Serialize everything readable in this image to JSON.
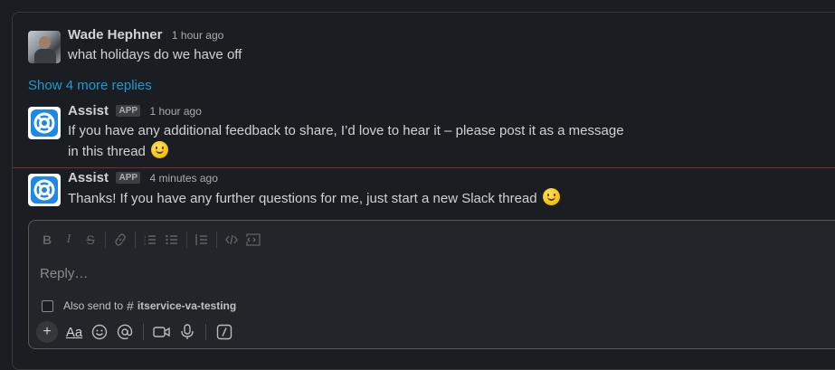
{
  "thread": {
    "messages": [
      {
        "sender": "Wade Hephner",
        "time": "1 hour ago",
        "text": "what holidays do we have off",
        "avatar": "user-photo"
      },
      {
        "sender": "Assist",
        "badge": "APP",
        "time": "1 hour ago",
        "text_line1": "If you have any additional feedback to share, I’d love to hear it – please post it as a message",
        "text_line2": "in this thread",
        "emoji": "slightly-smiling-face",
        "avatar": "assist-logo-icon"
      },
      {
        "sender": "Assist",
        "badge": "APP",
        "time": "4 minutes ago",
        "text": "Thanks! If you have any further questions for me, just start a new Slack thread",
        "emoji": "slightly-smiling-face",
        "avatar": "assist-logo-icon"
      }
    ],
    "more_replies_label": "Show 4 more replies"
  },
  "composer": {
    "placeholder": "Reply…",
    "also_send_label": "Also send to",
    "channel_hash": "#",
    "channel_name": "itservice-va-testing",
    "format_icons": [
      "bold",
      "italic",
      "strikethrough",
      "link",
      "ordered-list",
      "bulleted-list",
      "blockquote",
      "code",
      "code-block"
    ],
    "bottom_icons": [
      "plus",
      "text-formatting",
      "emoji",
      "mention",
      "video",
      "microphone",
      "slash-command"
    ],
    "aa_label": "Aa"
  },
  "colors": {
    "background": "#1a1d21",
    "link": "#1d9bd1",
    "new_divider": "#7a2d2d"
  }
}
